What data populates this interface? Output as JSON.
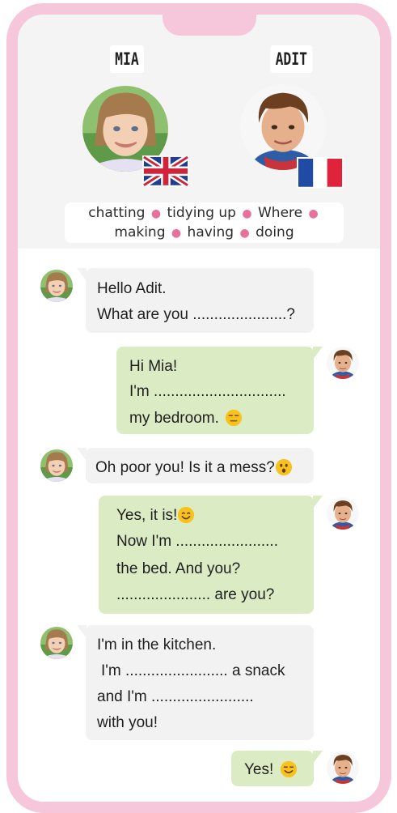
{
  "profiles": {
    "left": {
      "name": "MIA",
      "flag": "uk-flag-icon"
    },
    "right": {
      "name": "ADIT",
      "flag": "france-flag-icon"
    }
  },
  "word_bank": {
    "line1": [
      "chatting",
      "tidying up",
      "Where"
    ],
    "line2": [
      "making",
      "having",
      "doing"
    ]
  },
  "messages": [
    {
      "from": "mia",
      "lines": [
        "Hello Adit.",
        "What are you ......................?"
      ]
    },
    {
      "from": "adit",
      "lines": [
        "Hi Mia!",
        "I'm  ...............................",
        "my bedroom."
      ]
    },
    {
      "from": "mia",
      "lines": [
        "Oh poor you! Is it a mess?"
      ]
    },
    {
      "from": "adit",
      "lines": [
        "Yes, it is!",
        "Now I'm ........................",
        "the bed. And you?",
        "...................... are you?"
      ]
    },
    {
      "from": "mia",
      "lines": [
        "I'm in the kitchen.",
        "I'm ........................ a snack",
        "and I'm ........................",
        "with you!"
      ]
    },
    {
      "from": "adit",
      "lines": [
        "Yes!"
      ]
    }
  ],
  "colors": {
    "frame": "#f6c6da",
    "header_bg": "#f4f4f4",
    "bubble_left": "#f2f2f2",
    "bubble_right": "#dbecc4",
    "word_dot": "#e8709d",
    "emoji": "#f7c21b"
  },
  "emoji_icons": [
    "neutral-face-icon",
    "surprised-face-icon",
    "smiling-face-icon",
    "smiling-face-icon"
  ]
}
